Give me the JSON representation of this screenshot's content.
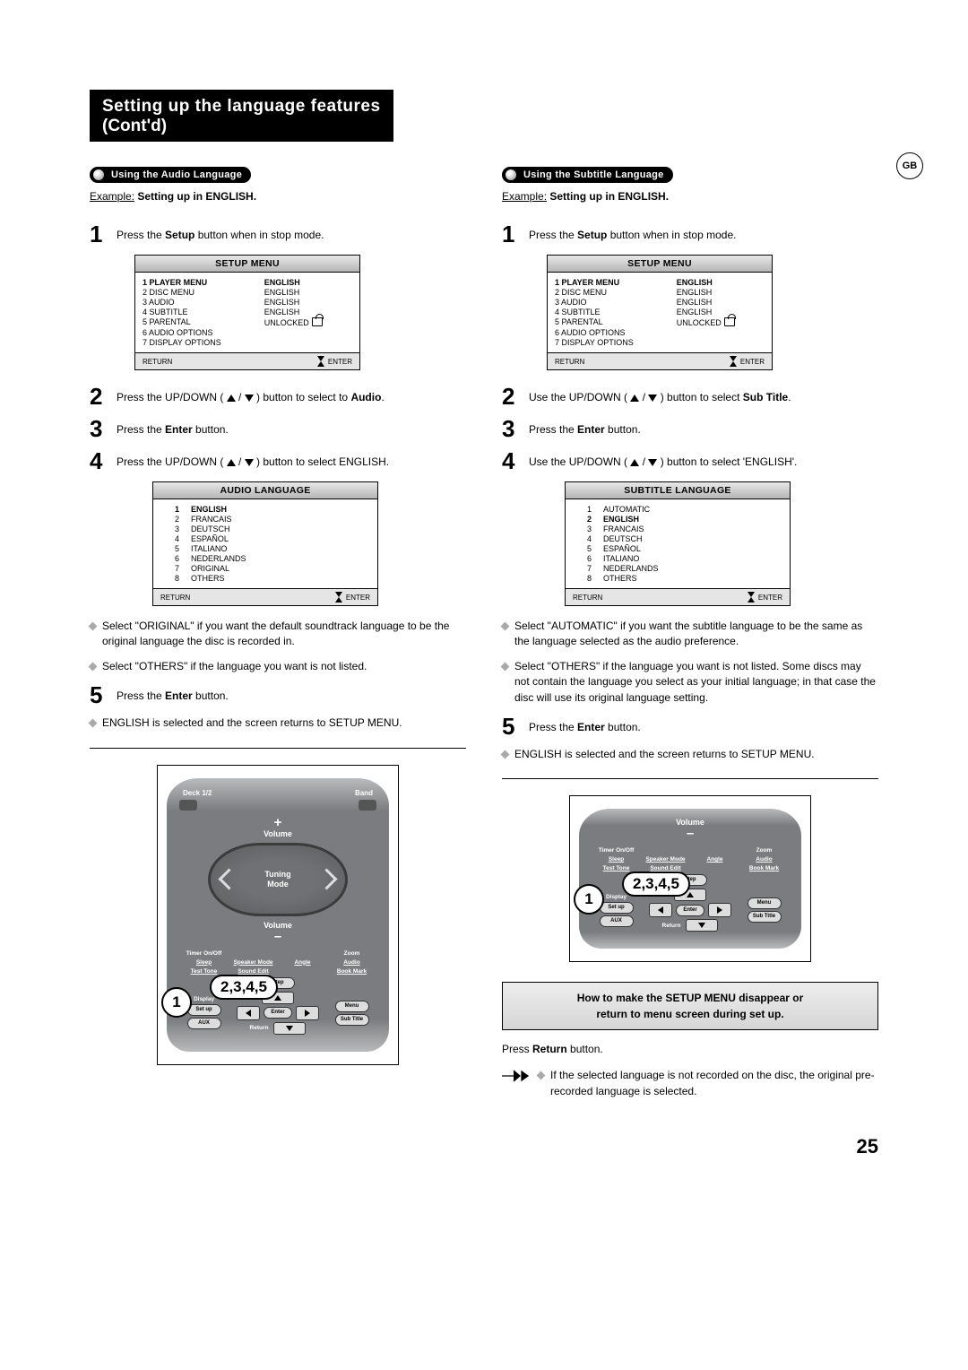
{
  "badge": "GB",
  "title": {
    "line1": "Setting up the language features",
    "line2": "(Cont'd)"
  },
  "left": {
    "pill": "Using the Audio Language",
    "example_prefix": "Example:",
    "example_rest": " Setting up in ENGLISH.",
    "steps": {
      "s1_a": "Press the ",
      "s1_b": "Setup",
      "s1_c": " button when in stop mode.",
      "s2_a": "Press the UP/DOWN ( ",
      "s2_b": " ) button to select to ",
      "s2_c": "Audio",
      "s2_d": ".",
      "s3_a": "Press the ",
      "s3_b": "Enter",
      "s3_c": " button.",
      "s4_a": "Press the UP/DOWN ( ",
      "s4_b": " ) button to select ENGLISH.",
      "s5_a": "Press the ",
      "s5_b": "Enter",
      "s5_c": " button."
    },
    "setup_menu": {
      "title": "SETUP MENU",
      "rows": [
        {
          "n": "1",
          "l": "PLAYER MENU",
          "v": "ENGLISH",
          "bold": true
        },
        {
          "n": "2",
          "l": "DISC MENU",
          "v": "ENGLISH"
        },
        {
          "n": "3",
          "l": "AUDIO",
          "v": "ENGLISH"
        },
        {
          "n": "4",
          "l": "SUBTITLE",
          "v": "ENGLISH"
        },
        {
          "n": "5",
          "l": "PARENTAL",
          "v": "UNLOCKED",
          "lock": true
        },
        {
          "n": "6",
          "l": "AUDIO OPTIONS",
          "v": ""
        },
        {
          "n": "7",
          "l": "DISPLAY OPTIONS",
          "v": ""
        }
      ],
      "footer": {
        "return": "RETURN",
        "enter": "ENTER"
      }
    },
    "lang_menu": {
      "title": "AUDIO LANGUAGE",
      "rows": [
        {
          "n": "1",
          "l": "ENGLISH",
          "bold": true
        },
        {
          "n": "2",
          "l": "FRANCAIS"
        },
        {
          "n": "3",
          "l": "DEUTSCH"
        },
        {
          "n": "4",
          "l": "ESPAÑOL"
        },
        {
          "n": "5",
          "l": "ITALIANO"
        },
        {
          "n": "6",
          "l": "NEDERLANDS"
        },
        {
          "n": "7",
          "l": "ORIGINAL"
        },
        {
          "n": "8",
          "l": "OTHERS"
        }
      ],
      "footer": {
        "return": "RETURN",
        "enter": "ENTER"
      }
    },
    "note1": "Select \"ORIGINAL\" if you want the default soundtrack language to be the original language the disc is recorded in.",
    "note2": "Select \"OTHERS\" if the language you want is not listed.",
    "note3": "ENGLISH is selected and the screen returns to SETUP MENU."
  },
  "right": {
    "pill": "Using the Subtitle Language",
    "example_prefix": "Example:",
    "example_rest": " Setting up in ENGLISH.",
    "steps": {
      "s1_a": "Press the ",
      "s1_b": "Setup",
      "s1_c": " button when in stop mode.",
      "s2_a": "Use the UP/DOWN ( ",
      "s2_b": " ) button to select ",
      "s2_c": "Sub Title",
      "s2_d": ".",
      "s3_a": "Press the ",
      "s3_b": "Enter",
      "s3_c": " button.",
      "s4_a": "Use the UP/DOWN ( ",
      "s4_b": " ) button to select 'ENGLISH'.",
      "s5_a": "Press the ",
      "s5_b": "Enter",
      "s5_c": " button."
    },
    "setup_menu": {
      "title": "SETUP MENU",
      "rows": [
        {
          "n": "1",
          "l": "PLAYER MENU",
          "v": "ENGLISH",
          "bold": true
        },
        {
          "n": "2",
          "l": "DISC MENU",
          "v": "ENGLISH"
        },
        {
          "n": "3",
          "l": "AUDIO",
          "v": "ENGLISH"
        },
        {
          "n": "4",
          "l": "SUBTITLE",
          "v": "ENGLISH"
        },
        {
          "n": "5",
          "l": "PARENTAL",
          "v": "UNLOCKED",
          "lock": true
        },
        {
          "n": "6",
          "l": "AUDIO OPTIONS",
          "v": ""
        },
        {
          "n": "7",
          "l": "DISPLAY OPTIONS",
          "v": ""
        }
      ],
      "footer": {
        "return": "RETURN",
        "enter": "ENTER"
      }
    },
    "lang_menu": {
      "title": "SUBTITLE LANGUAGE",
      "rows": [
        {
          "n": "1",
          "l": "AUTOMATIC"
        },
        {
          "n": "2",
          "l": "ENGLISH",
          "bold": true
        },
        {
          "n": "3",
          "l": "FRANCAIS"
        },
        {
          "n": "4",
          "l": "DEUTSCH"
        },
        {
          "n": "5",
          "l": "ESPAÑOL"
        },
        {
          "n": "6",
          "l": "ITALIANO"
        },
        {
          "n": "7",
          "l": "NEDERLANDS"
        },
        {
          "n": "8",
          "l": "OTHERS"
        }
      ],
      "footer": {
        "return": "RETURN",
        "enter": "ENTER"
      }
    },
    "note1": "Select \"AUTOMATIC\" if you want the subtitle language to be the same as the language selected as the audio preference.",
    "note2": "Select \"OTHERS\" if the language you want is not listed. Some discs may not contain the language you select as your initial language; in that case the disc will use its original language setting.",
    "note3": "ENGLISH is selected and the screen returns to SETUP MENU.",
    "notice": {
      "line1": "How to make the SETUP MENU disappear or",
      "line2": "return to menu screen during set up."
    },
    "press_return_a": "Press ",
    "press_return_b": "Return",
    "press_return_c": " button.",
    "pointer_note": "If the selected language is not recorded on the disc, the original pre-recorded language is selected."
  },
  "remote": {
    "deck": "Deck 1/2",
    "band": "Band",
    "volume": "Volume",
    "tuning": "Tuning",
    "mode": "Mode",
    "timer": "Timer On/Off",
    "zoom": "Zoom",
    "sleep": "Sleep",
    "speaker": "Speaker Mode",
    "angle": "Angle",
    "audio": "Audio",
    "test": "Test Tone",
    "sedit": "Sound Edit",
    "bookmark": "Book Mark",
    "step": "Step",
    "display": "Display",
    "setup": "Set up",
    "aux": "AUX",
    "return": "Return",
    "menu": "Menu",
    "enter": "Enter",
    "subtitle": "Sub Title",
    "callout1": "1",
    "callout2": "2,3,4,5"
  },
  "page_num": "25",
  "step_nums": {
    "n1": "1",
    "n2": "2",
    "n3": "3",
    "n4": "4",
    "n5": "5"
  }
}
